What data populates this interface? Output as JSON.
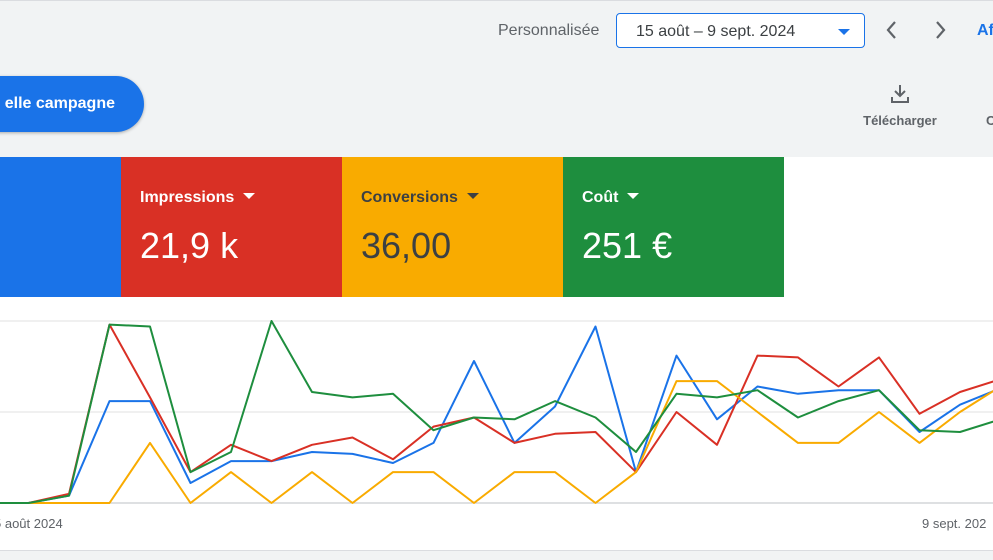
{
  "toolbar": {
    "range_label": "Personnalisée",
    "date_range": "15 août – 9 sept. 2024",
    "cut_text": "Af"
  },
  "actions": {
    "new_campaign": "elle campagne",
    "download": "Télécharger",
    "cut_tool": "C"
  },
  "metrics": [
    {
      "name": "Impressions",
      "value": "21,9 k",
      "color": "#d93025"
    },
    {
      "name": "Conversions",
      "value": "36,00",
      "color": "#f9ab00"
    },
    {
      "name": "Coût",
      "value": "251 €",
      "color": "#1e8e3e"
    }
  ],
  "clicks_card_color": "#1a73e8",
  "chart_data": {
    "type": "line",
    "x_labels": [
      "5 août 2024",
      "9 sept. 202"
    ],
    "grid": true,
    "legend": "none",
    "ylim": [
      0,
      100
    ],
    "series": [
      {
        "color": "#1a73e8",
        "values": [
          0,
          0,
          4,
          56,
          56,
          11,
          23,
          23,
          28,
          27,
          22,
          33,
          78,
          33,
          53,
          97,
          17,
          81,
          46,
          64,
          60,
          62,
          62,
          39,
          54,
          63
        ]
      },
      {
        "color": "#d93025",
        "values": [
          0,
          0,
          5,
          98,
          58,
          17,
          32,
          23,
          32,
          36,
          24,
          42,
          47,
          33,
          38,
          39,
          17,
          50,
          32,
          81,
          80,
          64,
          80,
          49,
          61,
          68
        ]
      },
      {
        "color": "#f9ab00",
        "values": [
          0,
          0,
          0,
          0,
          33,
          0,
          17,
          0,
          17,
          0,
          17,
          17,
          0,
          17,
          17,
          0,
          17,
          67,
          67,
          50,
          33,
          33,
          50,
          33,
          50,
          64
        ]
      },
      {
        "color": "#1e8e3e",
        "values": [
          0,
          0,
          4,
          98,
          97,
          17,
          28,
          100,
          61,
          58,
          60,
          40,
          47,
          46,
          56,
          47,
          28,
          60,
          58,
          62,
          47,
          56,
          62,
          40,
          39,
          46
        ]
      }
    ]
  }
}
